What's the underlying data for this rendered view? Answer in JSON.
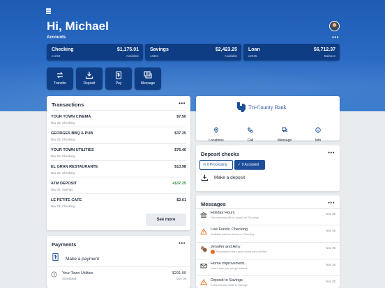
{
  "header": {
    "greeting": "Hi, Michael",
    "accounts_label": "Accounts",
    "more": "•••"
  },
  "accounts": [
    {
      "name": "Checking",
      "number": "x1234",
      "amount": "$1,175.01",
      "kind": "Available"
    },
    {
      "name": "Savings",
      "number": "x4321",
      "amount": "$2,423.25",
      "kind": "Available"
    },
    {
      "name": "Loan",
      "number": "x2345",
      "amount": "$6,712.37",
      "kind": "Balance"
    }
  ],
  "actions": [
    {
      "label": "Transfer",
      "icon": "transfer-icon"
    },
    {
      "label": "Deposit",
      "icon": "deposit-icon"
    },
    {
      "label": "Pay",
      "icon": "pay-icon"
    },
    {
      "label": "Message",
      "icon": "message-icon"
    }
  ],
  "transactions": {
    "title": "Transactions",
    "more": "•••",
    "items": [
      {
        "name": "YOUR TOWN CINEMA",
        "sub": "Nov 25, Checking",
        "amount": "$7.50",
        "positive": false
      },
      {
        "name": "GEORGES BBQ & PUB",
        "sub": "Nov 25, Checking",
        "amount": "$37.25",
        "positive": false
      },
      {
        "name": "YOUR TOWN UTILITIES",
        "sub": "Nov 25, Checking",
        "amount": "$76.46",
        "positive": false
      },
      {
        "name": "EL GRAN RESTAURANTE",
        "sub": "Nov 25, Checking",
        "amount": "$13.98",
        "positive": false
      },
      {
        "name": "ATM DEPOSIT",
        "sub": "Nov 25, Savings",
        "amount": "+$37.25",
        "positive": true
      },
      {
        "name": "LE PETITE CAFE",
        "sub": "Nov 04, Checking",
        "amount": "$2.61",
        "positive": false
      }
    ],
    "see_more": "See more"
  },
  "bank": {
    "name": "Tri-County Bank",
    "actions": [
      {
        "label": "Locations",
        "icon": "location-pin-icon"
      },
      {
        "label": "Call",
        "icon": "phone-icon"
      },
      {
        "label": "Message",
        "icon": "chat-icon"
      },
      {
        "label": "Info",
        "icon": "info-icon"
      }
    ]
  },
  "deposit_checks": {
    "title": "Deposit checks",
    "more": "•••",
    "processing": "0 Processing",
    "accepted": "9 Accepted",
    "make_deposit": "Make a deposit"
  },
  "messages": {
    "title": "Messages",
    "more": "•••",
    "items": [
      {
        "name": "Holiday Hours",
        "preview": "Our branches will be closed on Thursday.",
        "date": "Nov 25",
        "icon": "bank-icon"
      },
      {
        "name": "Low Funds: Checking",
        "preview": "Available balance is low on Checking",
        "date": "Nov 25",
        "icon": "warning-icon"
      },
      {
        "name": "Jennifer and Amy",
        "preview": "No problem! We'll send a new card out first...",
        "date": "Nov 25",
        "icon": "group-avatar-icon"
      },
      {
        "name": "Home improvement...",
        "preview": "Here's how you can get started",
        "date": "Nov 25",
        "icon": "mail-icon"
      },
      {
        "name": "Deposit to Savings",
        "preview": "A deposit was made to Savings",
        "date": "Nov 25",
        "icon": "warning-icon"
      }
    ]
  },
  "payments": {
    "title": "Payments",
    "more": "•••",
    "make_payment": "Make a payment",
    "bills": [
      {
        "name": "Your Town Utilities",
        "status": "Scheduled",
        "amount": "$291.00",
        "date": "Dec 05"
      }
    ]
  },
  "colors": {
    "brand_blue": "#0e3d84",
    "hero_blue": "#2a6bc4",
    "accent": "#1e4e9a",
    "positive": "#2e8b3a",
    "warning": "#e36a1a"
  }
}
